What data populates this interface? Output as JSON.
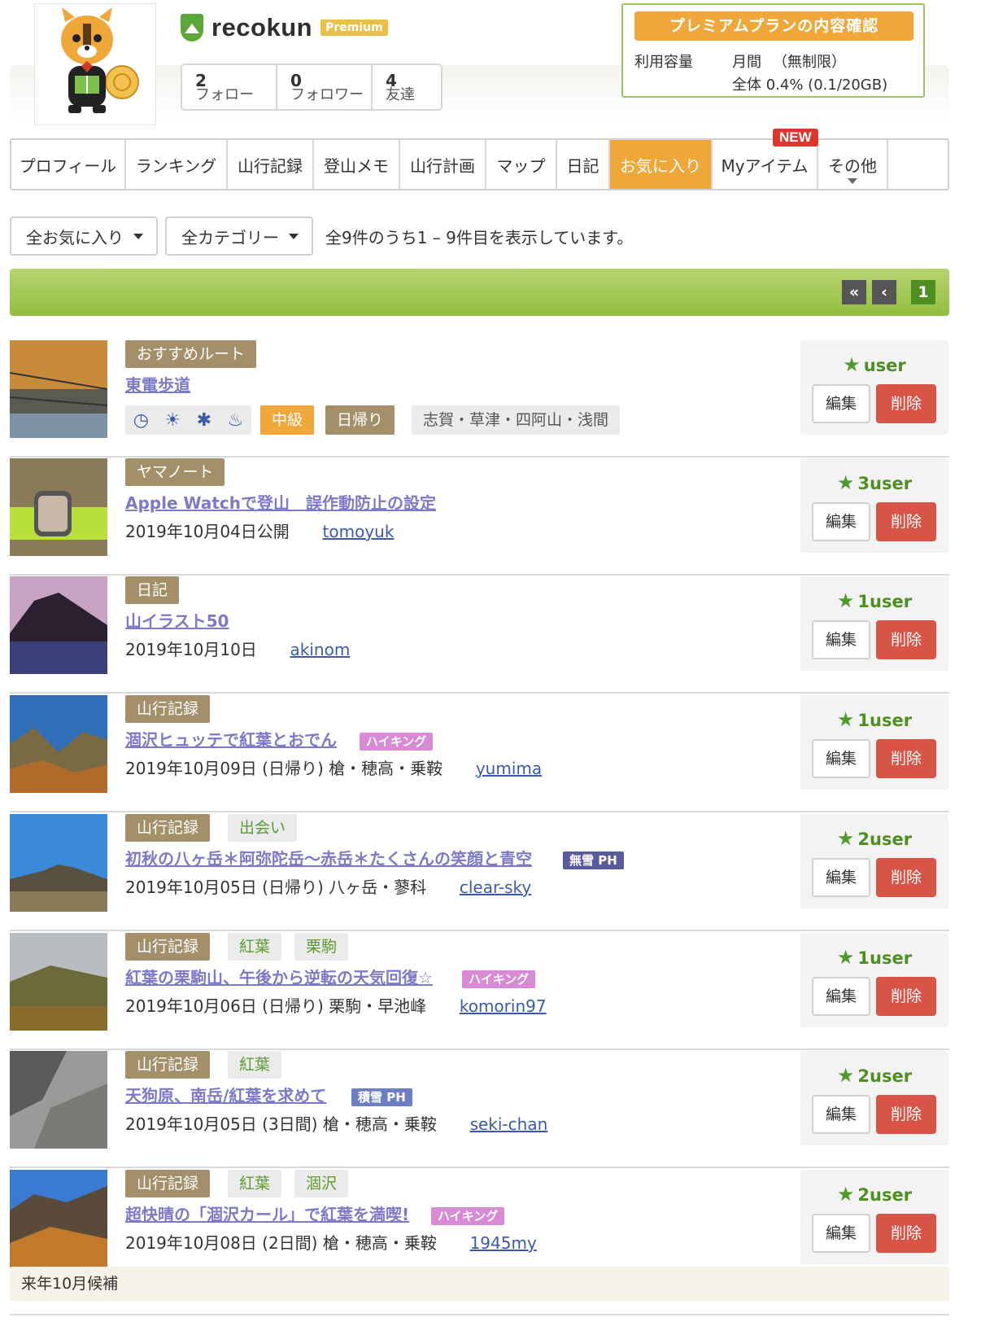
{
  "profile": {
    "username": "recokun",
    "premium_label": "Premium",
    "stats": [
      {
        "num": "2",
        "label": "フォロー"
      },
      {
        "num": "0",
        "label": "フォロワー"
      },
      {
        "num": "4",
        "label": "友達"
      }
    ]
  },
  "plan": {
    "button_label": "プレミアムプランの内容確認",
    "usage_label": "利用容量",
    "monthly_label": "月間",
    "monthly_value": "（無制限）",
    "total_value": "全体 0.4% (0.1/20GB)"
  },
  "tabs": [
    {
      "label": "プロフィール"
    },
    {
      "label": "ランキング"
    },
    {
      "label": "山行記録"
    },
    {
      "label": "登山メモ"
    },
    {
      "label": "山行計画"
    },
    {
      "label": "マップ"
    },
    {
      "label": "日記"
    },
    {
      "label": "お気に入り"
    },
    {
      "label": "Myアイテム"
    },
    {
      "label": "その他"
    }
  ],
  "new_badge": "NEW",
  "filters": {
    "favorites_filter": "全お気に入り",
    "category_filter": "全カテゴリー",
    "count_text": "全9件のうち1 – 9件目を表示しています。"
  },
  "pagination": {
    "current_page": "1"
  },
  "items": [
    {
      "category": "おすすめルート",
      "title": "東電歩道",
      "level": "中級",
      "duration": "日帰り",
      "area": "志賀・草津・四阿山・浅間",
      "favs": "user",
      "edit": "編集",
      "delete": "削除"
    },
    {
      "category": "ヤマノート",
      "title": "Apple Watchで登山　誤作動防止の設定",
      "date": "2019年10月04日公開",
      "user": "tomoyuk",
      "favs": "3user",
      "edit": "編集",
      "delete": "削除"
    },
    {
      "category": "日記",
      "title": "山イラスト50",
      "date": "2019年10月10日",
      "user": "akinom",
      "favs": "1user",
      "edit": "編集",
      "delete": "削除"
    },
    {
      "category": "山行記録",
      "title": "涸沢ヒュッテで紅葉とおでん",
      "badge": "ハイキング",
      "date": "2019年10月09日 (日帰り) 槍・穂高・乗鞍",
      "user": "yumima",
      "favs": "1user",
      "edit": "編集",
      "delete": "削除"
    },
    {
      "category": "山行記録",
      "tags": [
        "出会い"
      ],
      "title": "初秋の八ヶ岳＊阿弥陀岳〜赤岳＊たくさんの笑顔と青空",
      "badge": "無雪 PH",
      "date": "2019年10月05日 (日帰り) 八ヶ岳・蓼科",
      "user": "clear-sky",
      "favs": "2user",
      "edit": "編集",
      "delete": "削除"
    },
    {
      "category": "山行記録",
      "tags": [
        "紅葉",
        "栗駒"
      ],
      "title": "紅葉の栗駒山、午後から逆転の天気回復☆",
      "badge": "ハイキング",
      "date": "2019年10月06日 (日帰り) 栗駒・早池峰",
      "user": "komorin97",
      "favs": "1user",
      "edit": "編集",
      "delete": "削除"
    },
    {
      "category": "山行記録",
      "tags": [
        "紅葉"
      ],
      "title": "天狗原、南岳/紅葉を求めて",
      "badge": "積雪 PH",
      "date": "2019年10月05日 (3日間) 槍・穂高・乗鞍",
      "user": "seki-chan",
      "favs": "2user",
      "edit": "編集",
      "delete": "削除"
    },
    {
      "category": "山行記録",
      "tags": [
        "紅葉",
        "涸沢"
      ],
      "title": "超快晴の「涸沢カール」で紅葉を満喫!",
      "badge": "ハイキング",
      "date": "2019年10月08日 (2日間) 槍・穂高・乗鞍",
      "user": "1945my",
      "favs": "2user",
      "edit": "編集",
      "delete": "削除"
    }
  ],
  "memo": "来年10月候補",
  "colors": {
    "accent_orange": "#f0a73a",
    "brand_green": "#93bf3e",
    "delete_red": "#d75447",
    "link_purple": "#7b79c8"
  }
}
